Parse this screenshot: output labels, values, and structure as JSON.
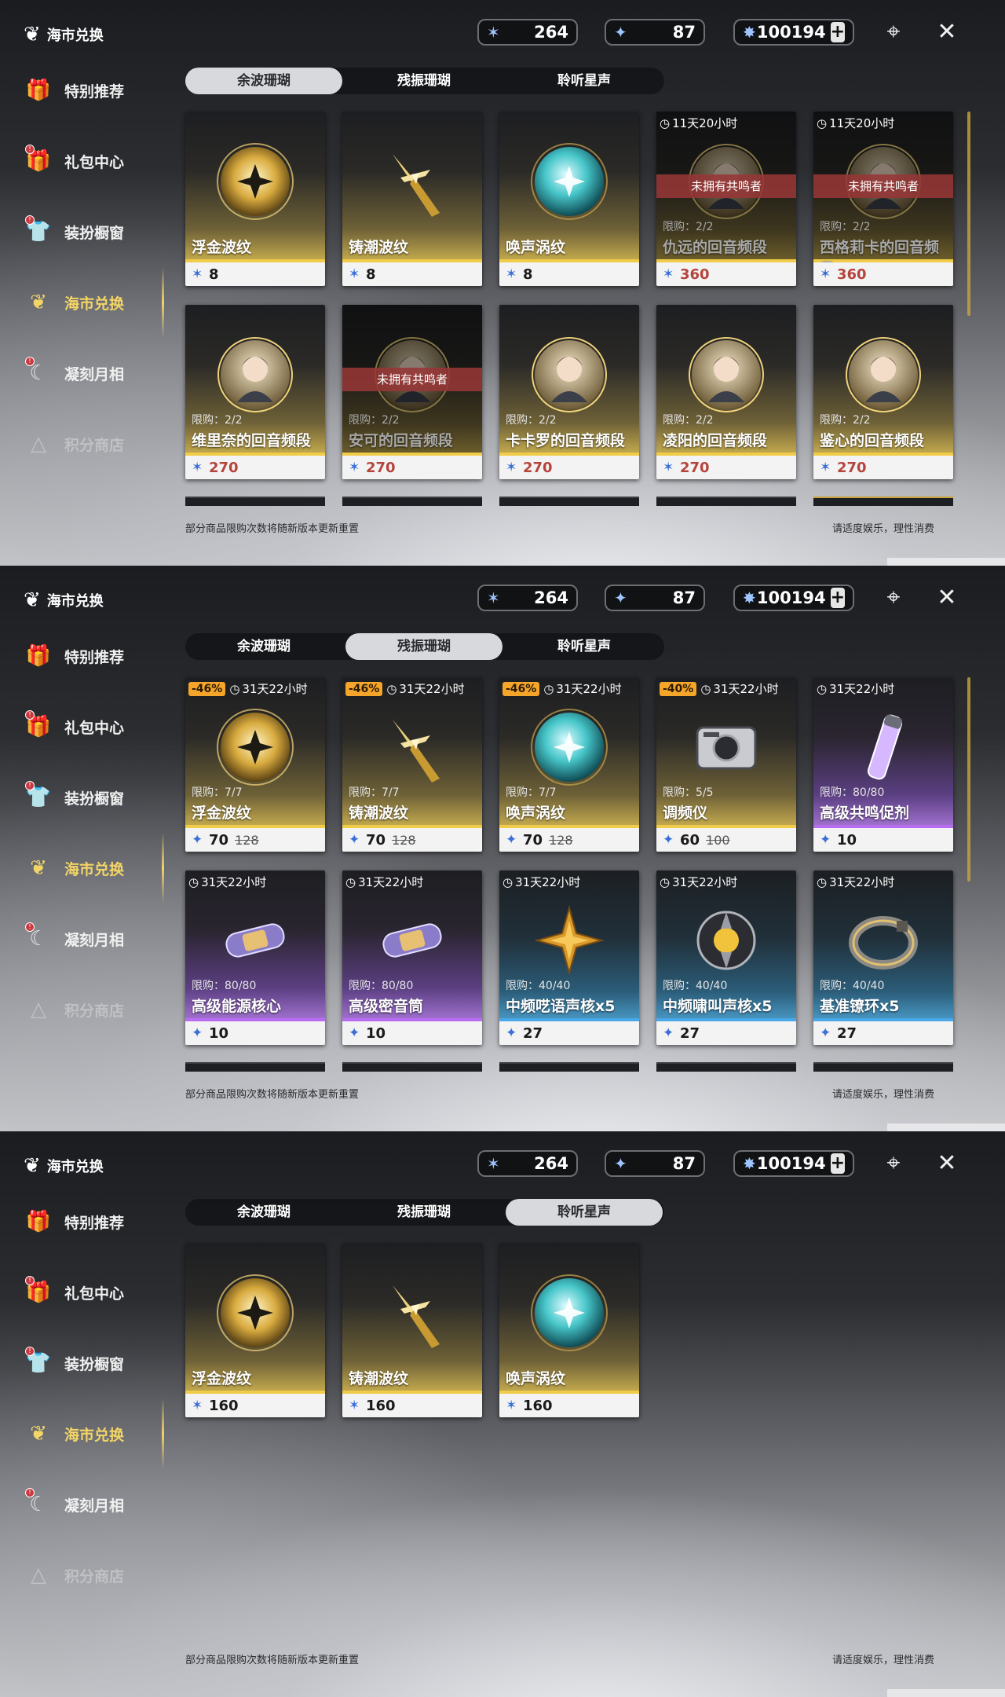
{
  "sidebar": {
    "brand": "海市兑换",
    "items": [
      {
        "label": "特别推荐",
        "icon": "gift-box-icon"
      },
      {
        "label": "礼包中心",
        "icon": "gift-icon"
      },
      {
        "label": "装扮橱窗",
        "icon": "wardrobe-icon"
      },
      {
        "label": "海市兑换",
        "icon": "coral-icon"
      },
      {
        "label": "凝刻月相",
        "icon": "moon-icon"
      },
      {
        "label": "积分商店",
        "icon": "triangle-icon"
      }
    ]
  },
  "currencies": {
    "coral": "264",
    "afterglow": "87",
    "astrite": "100194",
    "add": "+"
  },
  "tabs": [
    "余波珊瑚",
    "残振珊瑚",
    "聆听星声"
  ],
  "footer": {
    "left": "部分商品限购次数将随新版本更新重置",
    "right": "请适度娱乐，理性消费"
  },
  "panels": [
    {
      "active_tab": 0,
      "cards": [
        {
          "name": "浮金波纹",
          "price": "8",
          "rarity": "gold",
          "icon": "gold-orb-icon"
        },
        {
          "name": "铸潮波纹",
          "price": "8",
          "rarity": "gold",
          "icon": "sword-icon"
        },
        {
          "name": "唤声涡纹",
          "price": "8",
          "rarity": "gold",
          "icon": "teal-orb-icon"
        },
        {
          "name": "仇远的回音频段",
          "price": "360",
          "price_red": true,
          "rarity": "gold",
          "limit": "限购：2/2",
          "timer": "11天20小时",
          "banner": "未拥有共鸣者",
          "dimmed": true,
          "icon": "portrait-icon"
        },
        {
          "name": "西格莉卡的回音频段",
          "price": "360",
          "price_red": true,
          "rarity": "gold",
          "limit": "限购：2/2",
          "timer": "11天20小时",
          "banner": "未拥有共鸣者",
          "dimmed": true,
          "icon": "portrait-icon"
        },
        {
          "name": "维里奈的回音频段",
          "price": "270",
          "price_red": true,
          "rarity": "gold",
          "limit": "限购：2/2",
          "icon": "portrait-icon"
        },
        {
          "name": "安可的回音频段",
          "price": "270",
          "price_red": true,
          "rarity": "gold",
          "limit": "限购：2/2",
          "banner": "未拥有共鸣者",
          "dimmed": true,
          "icon": "portrait-icon"
        },
        {
          "name": "卡卡罗的回音频段",
          "price": "270",
          "price_red": true,
          "rarity": "gold",
          "limit": "限购：2/2",
          "icon": "portrait-icon"
        },
        {
          "name": "凌阳的回音频段",
          "price": "270",
          "price_red": true,
          "rarity": "gold",
          "limit": "限购：2/2",
          "icon": "portrait-icon"
        },
        {
          "name": "鉴心的回音频段",
          "price": "270",
          "price_red": true,
          "rarity": "gold",
          "limit": "限购：2/2",
          "icon": "portrait-icon"
        }
      ]
    },
    {
      "active_tab": 1,
      "cards": [
        {
          "name": "浮金波纹",
          "price": "70",
          "old_price": "128",
          "rarity": "gold",
          "limit": "限购：7/7",
          "timer": "31天22小时",
          "discount": "-46%",
          "icon": "gold-orb-icon"
        },
        {
          "name": "铸潮波纹",
          "price": "70",
          "old_price": "128",
          "rarity": "gold",
          "limit": "限购：7/7",
          "timer": "31天22小时",
          "discount": "-46%",
          "icon": "sword-icon"
        },
        {
          "name": "唤声涡纹",
          "price": "70",
          "old_price": "128",
          "rarity": "gold",
          "limit": "限购：7/7",
          "timer": "31天22小时",
          "discount": "-46%",
          "icon": "teal-orb-icon"
        },
        {
          "name": "调频仪",
          "price": "60",
          "old_price": "100",
          "rarity": "gold",
          "limit": "限购：5/5",
          "timer": "31天22小时",
          "discount": "-40%",
          "icon": "device-icon"
        },
        {
          "name": "高级共鸣促剂",
          "price": "10",
          "rarity": "purple",
          "limit": "限购：80/80",
          "timer": "31天22小时",
          "icon": "vial-icon"
        },
        {
          "name": "高级能源核心",
          "price": "10",
          "rarity": "purple",
          "limit": "限购：80/80",
          "timer": "31天22小时",
          "icon": "capsule-icon"
        },
        {
          "name": "高级密音筒",
          "price": "10",
          "rarity": "purple",
          "limit": "限购：80/80",
          "timer": "31天22小时",
          "icon": "capsule-icon"
        },
        {
          "name": "中频呓语声核x5",
          "price": "27",
          "rarity": "blue",
          "limit": "限购：40/40",
          "timer": "31天22小时",
          "icon": "star-icon"
        },
        {
          "name": "中频啸叫声核x5",
          "price": "27",
          "rarity": "blue",
          "limit": "限购：40/40",
          "timer": "31天22小时",
          "icon": "core-icon"
        },
        {
          "name": "基准镣环x5",
          "price": "27",
          "rarity": "blue",
          "limit": "限购：40/40",
          "timer": "31天22小时",
          "icon": "ring-icon"
        }
      ]
    },
    {
      "active_tab": 2,
      "cards": [
        {
          "name": "浮金波纹",
          "price": "160",
          "rarity": "gold",
          "icon": "gold-orb-icon",
          "currency": "star"
        },
        {
          "name": "铸潮波纹",
          "price": "160",
          "rarity": "gold",
          "icon": "sword-icon",
          "currency": "star"
        },
        {
          "name": "唤声涡纹",
          "price": "160",
          "rarity": "gold",
          "icon": "teal-orb-icon",
          "currency": "star"
        }
      ]
    }
  ]
}
